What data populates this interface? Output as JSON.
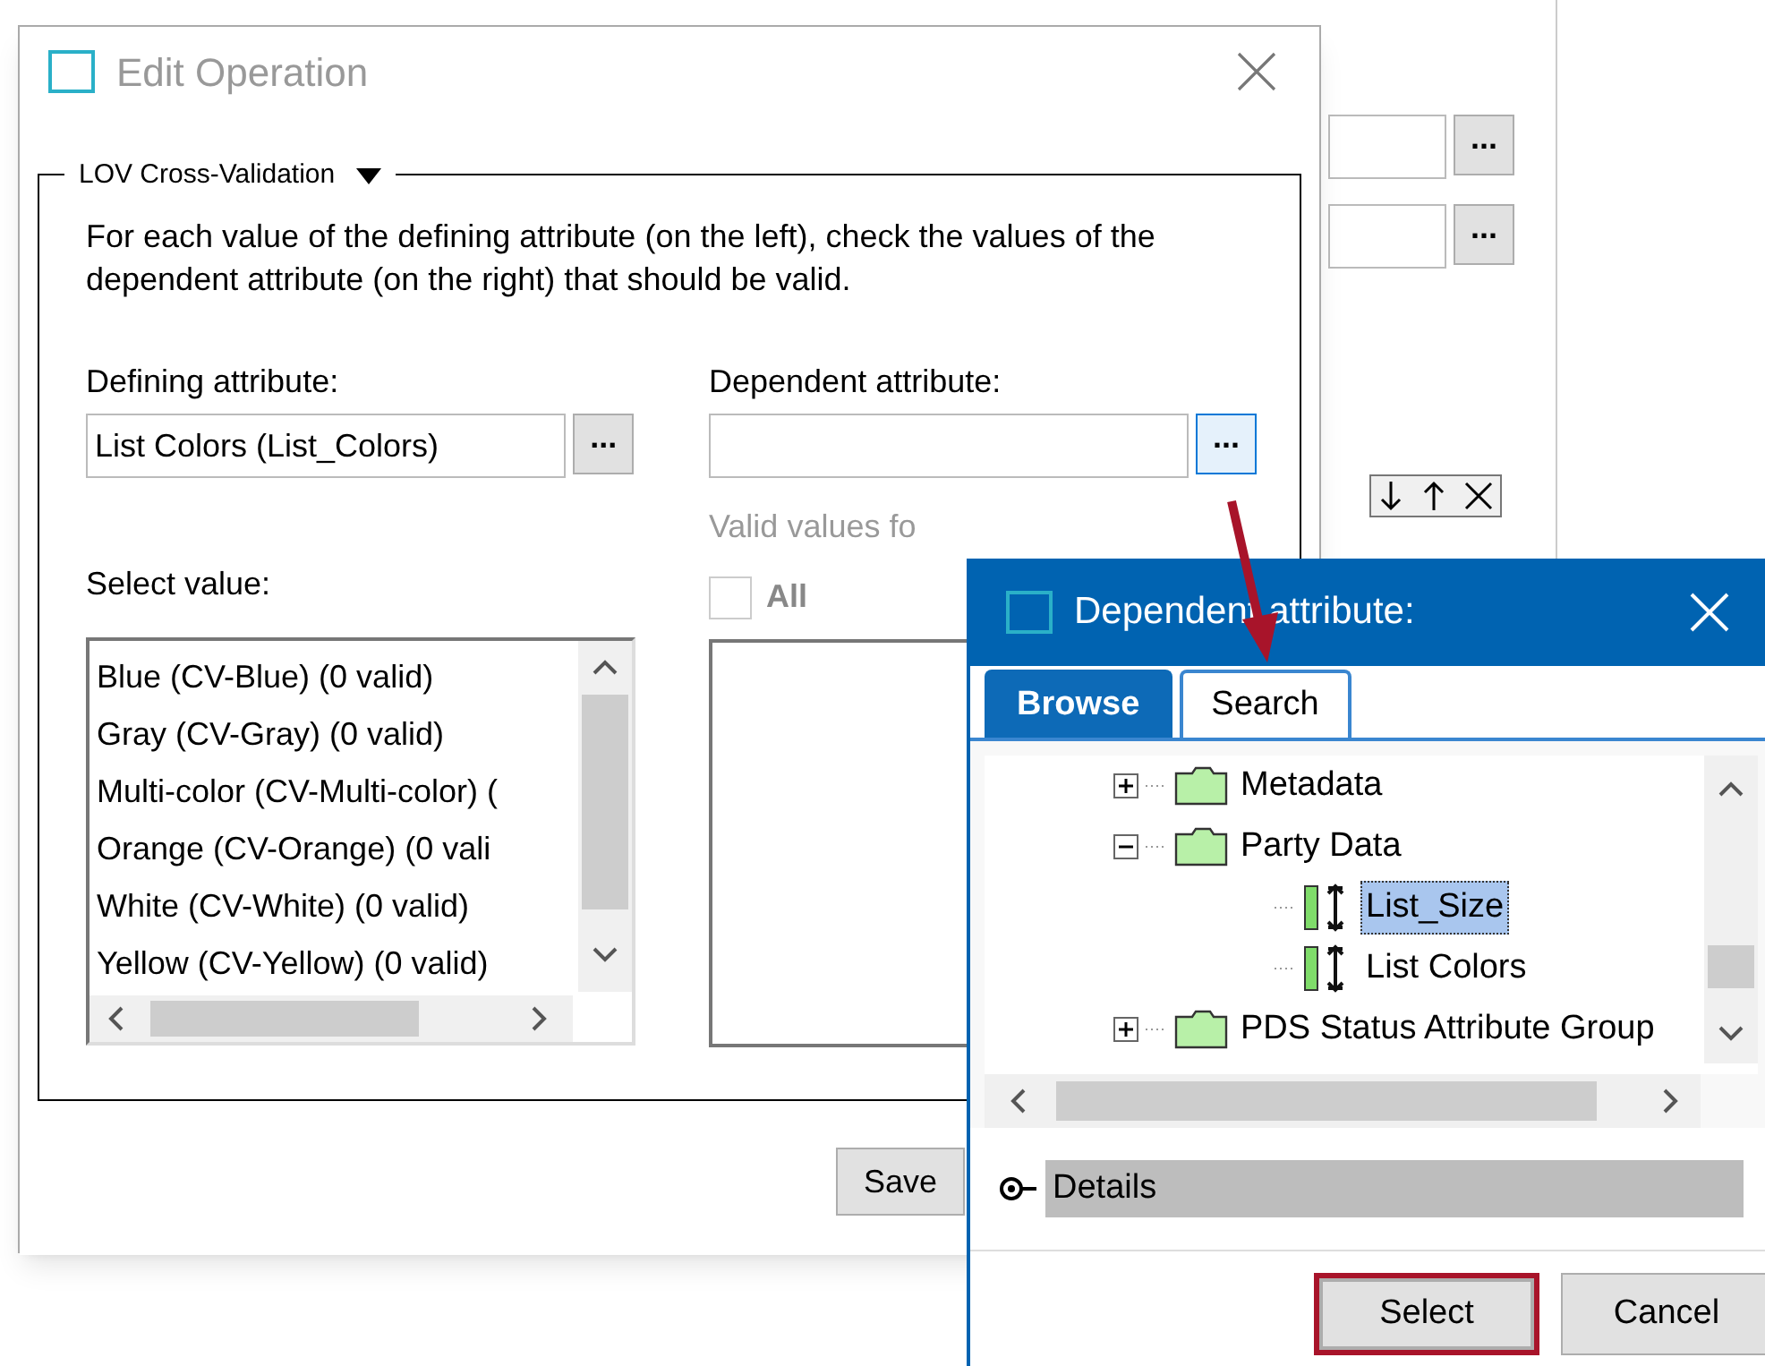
{
  "background": {
    "browse_buttons": [
      "...",
      "..."
    ]
  },
  "edit_window": {
    "title": "Edit Operation",
    "group": {
      "legend": "LOV Cross-Validation",
      "description": "For each value of the defining attribute (on the left), check the values of the dependent attribute (on the right) that should be valid.",
      "defining": {
        "label": "Defining attribute:",
        "value": "List Colors (List_Colors)",
        "button": "..."
      },
      "dependent": {
        "label": "Dependent attribute:",
        "button": "...",
        "focused": true
      },
      "valid_values_label": "Valid values fo",
      "all": {
        "label": "All",
        "checked": false,
        "disabled": true
      },
      "select_label": "Select value:",
      "values": [
        {
          "label": "Blue (CV-Blue) (0 valid)",
          "selected": false
        },
        {
          "label": "Gray (CV-Gray) (0 valid)",
          "selected": false
        },
        {
          "label": "Multi-color (CV-Multi-color) (",
          "selected": false
        },
        {
          "label": "Orange (CV-Orange) (0 vali",
          "selected": false
        },
        {
          "label": "White (CV-White) (0 valid)",
          "selected": false
        },
        {
          "label": "Yellow (CV-Yellow) (0 valid)",
          "selected": false
        }
      ]
    },
    "buttons": [
      "Save"
    ]
  },
  "dialog": {
    "title": "Dependent attribute:",
    "tabs": [
      {
        "label": "Browse",
        "selected": true
      },
      {
        "label": "Search",
        "selected": false
      }
    ],
    "tree": [
      {
        "kind": "folder",
        "label": "Metadata",
        "expanded": false,
        "selected": false
      },
      {
        "kind": "folder",
        "label": "Party Data",
        "expanded": true,
        "selected": false,
        "children": [
          {
            "kind": "attribute",
            "label": "List_Size",
            "selected": true
          },
          {
            "kind": "attribute",
            "label": "List Colors",
            "selected": false
          }
        ]
      },
      {
        "kind": "folder",
        "label": "PDS Status Attribute Group",
        "expanded": false,
        "selected": false
      }
    ],
    "details": "Details",
    "buttons": [
      {
        "label": "Select",
        "highlighted": true
      },
      {
        "label": "Cancel",
        "highlighted": false
      }
    ]
  }
}
